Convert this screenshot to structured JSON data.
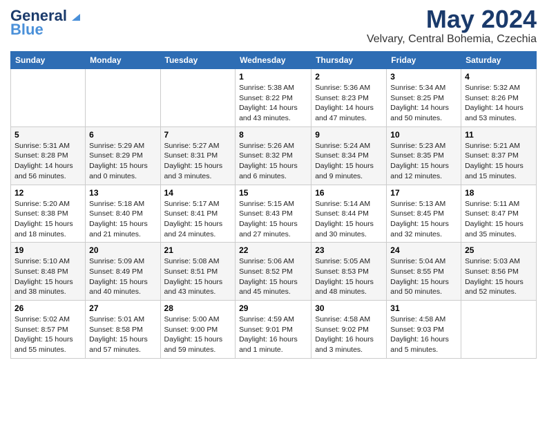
{
  "logo": {
    "general": "General",
    "blue": "Blue"
  },
  "header": {
    "month": "May 2024",
    "location": "Velvary, Central Bohemia, Czechia"
  },
  "weekdays": [
    "Sunday",
    "Monday",
    "Tuesday",
    "Wednesday",
    "Thursday",
    "Friday",
    "Saturday"
  ],
  "weeks": [
    [
      {
        "day": "",
        "info": ""
      },
      {
        "day": "",
        "info": ""
      },
      {
        "day": "",
        "info": ""
      },
      {
        "day": "1",
        "info": "Sunrise: 5:38 AM\nSunset: 8:22 PM\nDaylight: 14 hours\nand 43 minutes."
      },
      {
        "day": "2",
        "info": "Sunrise: 5:36 AM\nSunset: 8:23 PM\nDaylight: 14 hours\nand 47 minutes."
      },
      {
        "day": "3",
        "info": "Sunrise: 5:34 AM\nSunset: 8:25 PM\nDaylight: 14 hours\nand 50 minutes."
      },
      {
        "day": "4",
        "info": "Sunrise: 5:32 AM\nSunset: 8:26 PM\nDaylight: 14 hours\nand 53 minutes."
      }
    ],
    [
      {
        "day": "5",
        "info": "Sunrise: 5:31 AM\nSunset: 8:28 PM\nDaylight: 14 hours\nand 56 minutes."
      },
      {
        "day": "6",
        "info": "Sunrise: 5:29 AM\nSunset: 8:29 PM\nDaylight: 15 hours\nand 0 minutes."
      },
      {
        "day": "7",
        "info": "Sunrise: 5:27 AM\nSunset: 8:31 PM\nDaylight: 15 hours\nand 3 minutes."
      },
      {
        "day": "8",
        "info": "Sunrise: 5:26 AM\nSunset: 8:32 PM\nDaylight: 15 hours\nand 6 minutes."
      },
      {
        "day": "9",
        "info": "Sunrise: 5:24 AM\nSunset: 8:34 PM\nDaylight: 15 hours\nand 9 minutes."
      },
      {
        "day": "10",
        "info": "Sunrise: 5:23 AM\nSunset: 8:35 PM\nDaylight: 15 hours\nand 12 minutes."
      },
      {
        "day": "11",
        "info": "Sunrise: 5:21 AM\nSunset: 8:37 PM\nDaylight: 15 hours\nand 15 minutes."
      }
    ],
    [
      {
        "day": "12",
        "info": "Sunrise: 5:20 AM\nSunset: 8:38 PM\nDaylight: 15 hours\nand 18 minutes."
      },
      {
        "day": "13",
        "info": "Sunrise: 5:18 AM\nSunset: 8:40 PM\nDaylight: 15 hours\nand 21 minutes."
      },
      {
        "day": "14",
        "info": "Sunrise: 5:17 AM\nSunset: 8:41 PM\nDaylight: 15 hours\nand 24 minutes."
      },
      {
        "day": "15",
        "info": "Sunrise: 5:15 AM\nSunset: 8:43 PM\nDaylight: 15 hours\nand 27 minutes."
      },
      {
        "day": "16",
        "info": "Sunrise: 5:14 AM\nSunset: 8:44 PM\nDaylight: 15 hours\nand 30 minutes."
      },
      {
        "day": "17",
        "info": "Sunrise: 5:13 AM\nSunset: 8:45 PM\nDaylight: 15 hours\nand 32 minutes."
      },
      {
        "day": "18",
        "info": "Sunrise: 5:11 AM\nSunset: 8:47 PM\nDaylight: 15 hours\nand 35 minutes."
      }
    ],
    [
      {
        "day": "19",
        "info": "Sunrise: 5:10 AM\nSunset: 8:48 PM\nDaylight: 15 hours\nand 38 minutes."
      },
      {
        "day": "20",
        "info": "Sunrise: 5:09 AM\nSunset: 8:49 PM\nDaylight: 15 hours\nand 40 minutes."
      },
      {
        "day": "21",
        "info": "Sunrise: 5:08 AM\nSunset: 8:51 PM\nDaylight: 15 hours\nand 43 minutes."
      },
      {
        "day": "22",
        "info": "Sunrise: 5:06 AM\nSunset: 8:52 PM\nDaylight: 15 hours\nand 45 minutes."
      },
      {
        "day": "23",
        "info": "Sunrise: 5:05 AM\nSunset: 8:53 PM\nDaylight: 15 hours\nand 48 minutes."
      },
      {
        "day": "24",
        "info": "Sunrise: 5:04 AM\nSunset: 8:55 PM\nDaylight: 15 hours\nand 50 minutes."
      },
      {
        "day": "25",
        "info": "Sunrise: 5:03 AM\nSunset: 8:56 PM\nDaylight: 15 hours\nand 52 minutes."
      }
    ],
    [
      {
        "day": "26",
        "info": "Sunrise: 5:02 AM\nSunset: 8:57 PM\nDaylight: 15 hours\nand 55 minutes."
      },
      {
        "day": "27",
        "info": "Sunrise: 5:01 AM\nSunset: 8:58 PM\nDaylight: 15 hours\nand 57 minutes."
      },
      {
        "day": "28",
        "info": "Sunrise: 5:00 AM\nSunset: 9:00 PM\nDaylight: 15 hours\nand 59 minutes."
      },
      {
        "day": "29",
        "info": "Sunrise: 4:59 AM\nSunset: 9:01 PM\nDaylight: 16 hours\nand 1 minute."
      },
      {
        "day": "30",
        "info": "Sunrise: 4:58 AM\nSunset: 9:02 PM\nDaylight: 16 hours\nand 3 minutes."
      },
      {
        "day": "31",
        "info": "Sunrise: 4:58 AM\nSunset: 9:03 PM\nDaylight: 16 hours\nand 5 minutes."
      },
      {
        "day": "",
        "info": ""
      }
    ]
  ]
}
